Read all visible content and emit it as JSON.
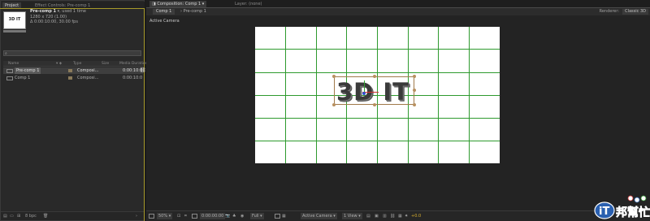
{
  "left": {
    "tabs": [
      "Project",
      "Effect Controls: Pre-comp 1"
    ],
    "thumb_text": "3D IT",
    "info": {
      "name": "Pre-comp 1",
      "used": ", used 1 time",
      "size": "1280 x 720 (1.00)",
      "duration": "Δ 0:00:10:00, 30.00 fps"
    },
    "columns": [
      "Name",
      "Type",
      "Size",
      "Media Duration"
    ],
    "items": [
      {
        "name": "Pre-comp 1",
        "type": "Composi...",
        "duration": "0:00:10:0"
      },
      {
        "name": "Comp 1",
        "type": "Composi...",
        "duration": "0:00:10:0"
      }
    ],
    "bottom": {
      "bpc": "8 bpc"
    }
  },
  "right": {
    "tabs": [
      "Composition: Comp 1",
      "Layer: (none)"
    ],
    "breadcrumbs": [
      "Comp 1",
      "Pre-comp 1"
    ],
    "renderer_label": "Renderer:",
    "renderer_value": "Classic 3D",
    "camera_label": "Active Camera",
    "comp_text": "3D IT",
    "toolbar": {
      "zoom": "50%",
      "timecode": "0:00:00:00",
      "resolution": "Full",
      "camera": "Active Camera",
      "views": "1 View",
      "exposure": "+0.0"
    }
  },
  "colors": {
    "grid": "#2e9a2e",
    "panel_highlight": "#a89a2a",
    "bbox": "#a07a4a"
  }
}
